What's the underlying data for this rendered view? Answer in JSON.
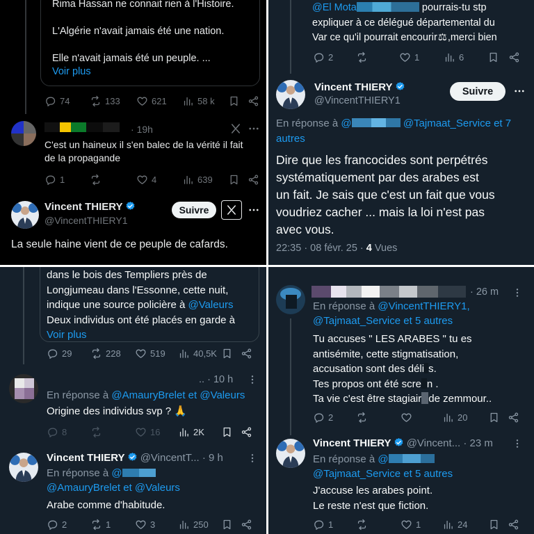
{
  "colors": {
    "accent": "#1d9bf0",
    "dark_bg": "#000000",
    "dim_bg": "#15202b"
  },
  "panel_tl": {
    "quote_lines": [
      "Rima Hassan ne connait rien à l'Histoire.",
      "L'Algérie n'avait jamais été une nation.",
      "Elle n'avait jamais été un peuple. ..."
    ],
    "voir_plus": "Voir plus",
    "tweet1_actions": {
      "replies": "74",
      "reposts": "133",
      "likes": "621",
      "views": "58 k"
    },
    "reply_time": "19h",
    "reply_lines": [
      "C'est un haineux il s'en balec de la vérité il fait",
      "de la propagande"
    ],
    "reply_actions": {
      "replies": "1",
      "reposts": "",
      "likes": "4",
      "views": "639"
    },
    "author_name": "Vincent THIERY",
    "author_handle": "@VincentTHIERY1",
    "follow": "Suivre",
    "tweet_text": "La seule haine vient de ce peuple de cafards."
  },
  "panel_tr": {
    "top_mention": "@El Mota",
    "top_lines": [
      "pourrais-tu stp",
      "expliquer à ce délégué départemental du",
      "Var ce qu'il pourrait encourir",
      ",merci bien"
    ],
    "top_actions": {
      "replies": "2",
      "reposts": "",
      "likes": "1",
      "views": "6"
    },
    "author_name": "Vincent THIERY",
    "author_handle": "@VincentTHIERY1",
    "follow": "Suivre",
    "reply_prefix": "En réponse à",
    "reply_mentions": "@Tajmaat_Service et 7",
    "reply_mentions2": "autres",
    "tweet_lines": [
      "Dire que les francocides sont perpétrés",
      "systématiquement par des arabes est",
      "un fait. Je sais que c'est un fait que vous",
      "voudriez cacher ... mais la loi n'est pas",
      "avec vous."
    ],
    "timestamp": "22:35 · 08 févr. 25 · ",
    "views_count": "4",
    "views_label": " Vues"
  },
  "panel_bl": {
    "quote_lines": [
      "dans le bois des Templiers près de",
      "Longjumeau dans l'Essonne, cette nuit,",
      "indique une source policière à ",
      "Deux individus ont été placés en garde à"
    ],
    "quote_mention": "@Valeurs",
    "voir_plus": "Voir plus",
    "tweet1_actions": {
      "replies": "29",
      "reposts": "228",
      "likes": "519",
      "views": "40,5K"
    },
    "reply_time": "10 h",
    "reply_prefix": "En réponse à",
    "reply_mentions": "@AmauryBrelet et @Valeurs",
    "reply_text": "Origine des individus svp ? 🙏",
    "reply_actions": {
      "replies": "8",
      "reposts": "",
      "likes": "16",
      "views": "2K"
    },
    "author_name": "Vincent THIERY",
    "author_handle": "@VincentT...",
    "author_time": "· 9 h",
    "reply2_prefix": "En réponse à",
    "reply2_mention_start": "@",
    "reply2_mentions": "@AmauryBrelet et @Valeurs",
    "tweet_text": "Arabe comme d'habitude.",
    "tweet_actions": {
      "replies": "2",
      "reposts": "1",
      "likes": "3",
      "views": "250"
    }
  },
  "panel_br": {
    "top_time": "· 26 m",
    "top_reply_prefix": "En réponse à",
    "top_reply_mentions": "@VincentTHIERY1,",
    "top_reply_mentions2": "@Tajmaat_Service et 5 autres",
    "top_lines": [
      "Tu accuses \" LES ARABES \" tu es",
      "antisémite, cette stigmatisation,",
      "accusation sont des déli",
      "s.",
      "Tes propos ont été scre",
      "n .",
      "Ta vie c'est être stagiair",
      "de zemmour.."
    ],
    "top_actions": {
      "replies": "2",
      "reposts": "",
      "likes": "",
      "views": "20"
    },
    "author_name": "Vincent THIERY",
    "author_handle": "@Vincent...",
    "author_time": "· 23 m",
    "reply_prefix": "En réponse à",
    "reply_mention_start": "@",
    "reply_mentions2": "@Tajmaat_Service et 5 autres",
    "tweet_lines": [
      "J'accuse les arabes point.",
      "Le reste n'est que fiction."
    ],
    "tweet_actions": {
      "replies": "1",
      "reposts": "",
      "likes": "1",
      "views": "24"
    }
  }
}
